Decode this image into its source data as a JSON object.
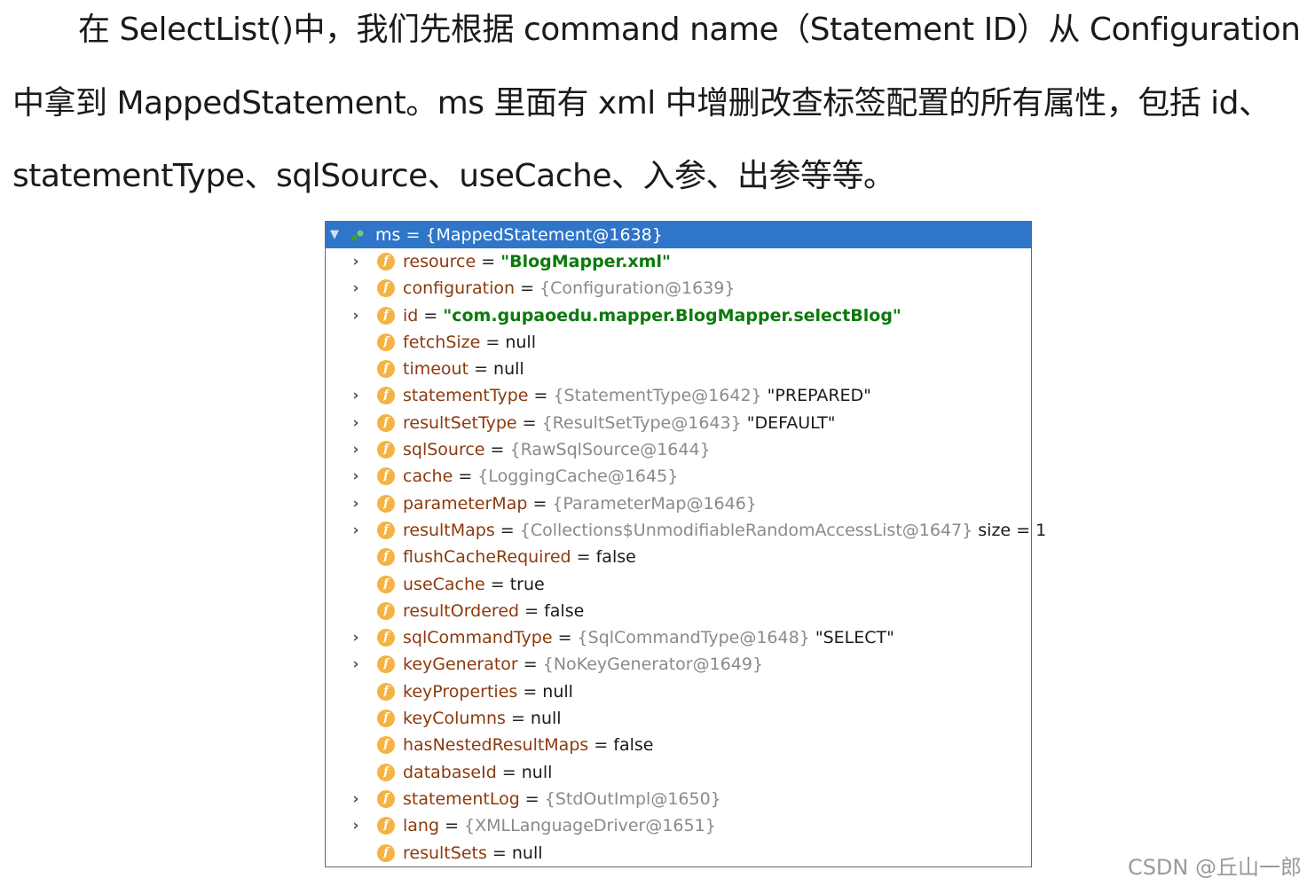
{
  "paragraph": {
    "line1": "在 SelectList()中，我们先根据 command name（Statement ID）从 Configuration",
    "line2": "中拿到 MappedStatement。ms 里面有 xml 中增删改查标签配置的所有属性，包括 id、",
    "line3": "statementType、sqlSource、useCache、入参、出参等等。"
  },
  "debugger": {
    "root": {
      "label": "ms = {MappedStatement@1638}",
      "icon": "object-icon",
      "expanded": true
    },
    "fields": [
      {
        "name": "resource",
        "ref": "",
        "value": "\"BlogMapper.xml\"",
        "kind": "string",
        "expandable": true
      },
      {
        "name": "configuration",
        "ref": "{Configuration@1639}",
        "value": "",
        "kind": "ref",
        "expandable": true
      },
      {
        "name": "id",
        "ref": "",
        "value": "\"com.gupaoedu.mapper.BlogMapper.selectBlog\"",
        "kind": "string",
        "expandable": true
      },
      {
        "name": "fetchSize",
        "ref": "",
        "value": "null",
        "kind": "literal",
        "expandable": false
      },
      {
        "name": "timeout",
        "ref": "",
        "value": "null",
        "kind": "literal",
        "expandable": false
      },
      {
        "name": "statementType",
        "ref": "{StatementType@1642}",
        "value": "\"PREPARED\"",
        "kind": "ref",
        "expandable": true
      },
      {
        "name": "resultSetType",
        "ref": "{ResultSetType@1643}",
        "value": "\"DEFAULT\"",
        "kind": "ref",
        "expandable": true
      },
      {
        "name": "sqlSource",
        "ref": "{RawSqlSource@1644}",
        "value": "",
        "kind": "ref",
        "expandable": true
      },
      {
        "name": "cache",
        "ref": "{LoggingCache@1645}",
        "value": "",
        "kind": "ref",
        "expandable": true
      },
      {
        "name": "parameterMap",
        "ref": "{ParameterMap@1646}",
        "value": "",
        "kind": "ref",
        "expandable": true
      },
      {
        "name": "resultMaps",
        "ref": "{Collections$UnmodifiableRandomAccessList@1647}",
        "value": "size = 1",
        "kind": "ref",
        "expandable": true
      },
      {
        "name": "flushCacheRequired",
        "ref": "",
        "value": "false",
        "kind": "literal",
        "expandable": false
      },
      {
        "name": "useCache",
        "ref": "",
        "value": "true",
        "kind": "literal",
        "expandable": false
      },
      {
        "name": "resultOrdered",
        "ref": "",
        "value": "false",
        "kind": "literal",
        "expandable": false
      },
      {
        "name": "sqlCommandType",
        "ref": "{SqlCommandType@1648}",
        "value": "\"SELECT\"",
        "kind": "ref",
        "expandable": true
      },
      {
        "name": "keyGenerator",
        "ref": "{NoKeyGenerator@1649}",
        "value": "",
        "kind": "ref",
        "expandable": true
      },
      {
        "name": "keyProperties",
        "ref": "",
        "value": "null",
        "kind": "literal",
        "expandable": false
      },
      {
        "name": "keyColumns",
        "ref": "",
        "value": "null",
        "kind": "literal",
        "expandable": false
      },
      {
        "name": "hasNestedResultMaps",
        "ref": "",
        "value": "false",
        "kind": "literal",
        "expandable": false
      },
      {
        "name": "databaseId",
        "ref": "",
        "value": "null",
        "kind": "literal",
        "expandable": false
      },
      {
        "name": "statementLog",
        "ref": "{StdOutImpl@1650}",
        "value": "",
        "kind": "ref",
        "expandable": true
      },
      {
        "name": "lang",
        "ref": "{XMLLanguageDriver@1651}",
        "value": "",
        "kind": "ref",
        "expandable": true
      },
      {
        "name": "resultSets",
        "ref": "",
        "value": "null",
        "kind": "literal",
        "expandable": false
      }
    ],
    "field_icon_letter": "f",
    "expander_glyph": "›",
    "colors": {
      "selection": "#2f75c8",
      "field_name": "#8b3a0e",
      "string_value": "#0b7a0b",
      "ref_value": "#8a8a8a",
      "field_icon": "#f5b343"
    }
  },
  "watermark": "CSDN @丘山一郎"
}
